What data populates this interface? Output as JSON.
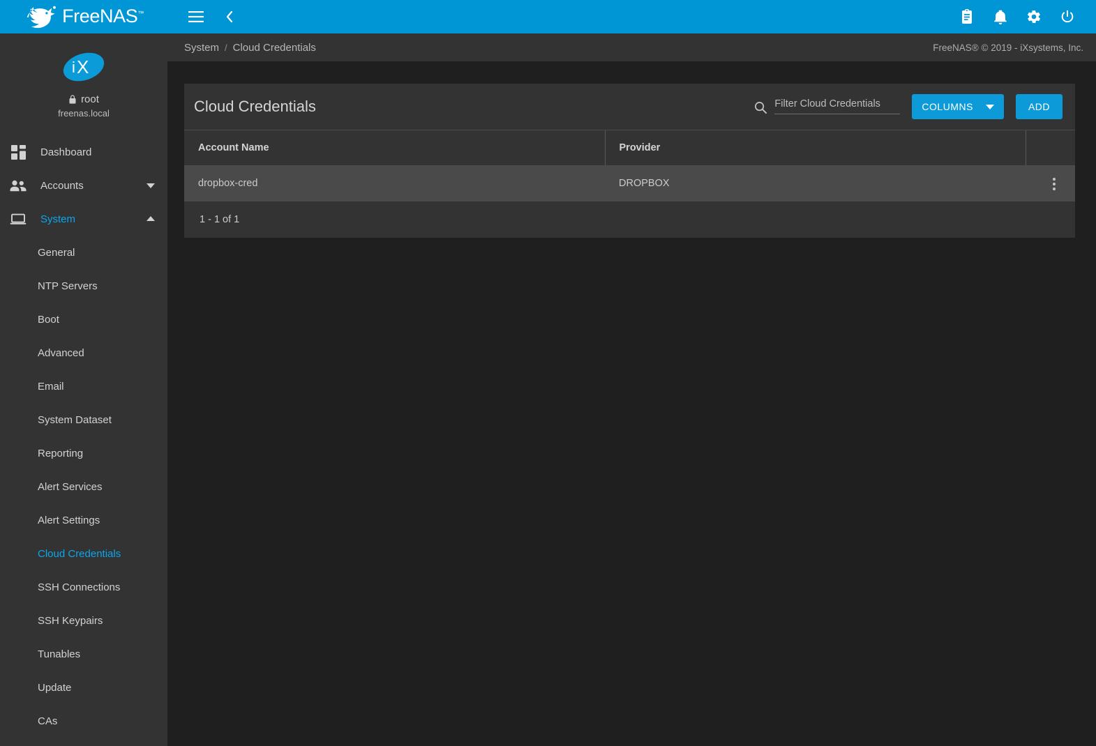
{
  "topbar": {
    "brand_name": "FreeNAS",
    "brand_tm": "™",
    "menu_icon": "hamburger-icon",
    "back_icon": "chevron-left-icon",
    "right_icons": [
      "clipboard-icon",
      "bell-icon",
      "gear-icon",
      "power-icon"
    ],
    "accent_color": "#0095d5"
  },
  "sidebar": {
    "user": "root",
    "host": "freenas.local",
    "lock_icon": "lock-icon",
    "items": [
      {
        "label": "Dashboard",
        "icon": "dashboard-grid-icon",
        "expandable": false,
        "active": false
      },
      {
        "label": "Accounts",
        "icon": "people-icon",
        "expandable": true,
        "expanded": false,
        "active": false
      },
      {
        "label": "System",
        "icon": "laptop-icon",
        "expandable": true,
        "expanded": true,
        "active": true
      }
    ],
    "system_children": [
      {
        "label": "General",
        "active": false
      },
      {
        "label": "NTP Servers",
        "active": false
      },
      {
        "label": "Boot",
        "active": false
      },
      {
        "label": "Advanced",
        "active": false
      },
      {
        "label": "Email",
        "active": false
      },
      {
        "label": "System Dataset",
        "active": false
      },
      {
        "label": "Reporting",
        "active": false
      },
      {
        "label": "Alert Services",
        "active": false
      },
      {
        "label": "Alert Settings",
        "active": false
      },
      {
        "label": "Cloud Credentials",
        "active": true
      },
      {
        "label": "SSH Connections",
        "active": false
      },
      {
        "label": "SSH Keypairs",
        "active": false
      },
      {
        "label": "Tunables",
        "active": false
      },
      {
        "label": "Update",
        "active": false
      },
      {
        "label": "CAs",
        "active": false
      }
    ],
    "active_color": "#0aa7ec"
  },
  "breadcrumb": {
    "root": "System",
    "separator": "/",
    "current": "Cloud Credentials"
  },
  "footer": {
    "copyright": "FreeNAS® © 2019 - iXsystems, Inc."
  },
  "card": {
    "title": "Cloud Credentials",
    "search": {
      "placeholder": "Filter Cloud Credentials",
      "value": "",
      "icon": "search-icon"
    },
    "columns_button": {
      "label": "COLUMNS",
      "icon": "chevron-down-icon"
    },
    "add_button": {
      "label": "ADD"
    },
    "table": {
      "headers": [
        "Account Name",
        "Provider",
        ""
      ],
      "rows": [
        {
          "account_name": "dropbox-cred",
          "provider": "DROPBOX",
          "menu_icon": "more-vertical-icon"
        }
      ]
    },
    "pagination": "1 - 1 of 1"
  }
}
